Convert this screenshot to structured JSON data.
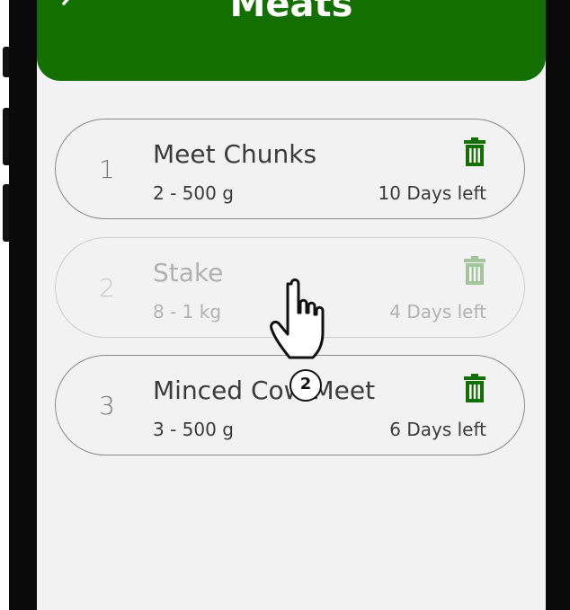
{
  "header": {
    "title": "Meats",
    "back_icon": "chevron-left-icon"
  },
  "items": [
    {
      "index": "1",
      "name": "Meet Chunks",
      "quantity": "2 - 500 g",
      "days_left": "10 Days left"
    },
    {
      "index": "2",
      "name": "Stake",
      "quantity": "8 - 1 kg",
      "days_left": "4 Days left"
    },
    {
      "index": "3",
      "name": "Minced Cow Meet",
      "quantity": "3 - 500 g",
      "days_left": "6 Days left"
    }
  ],
  "overlay": {
    "step_number": "2",
    "pointer_icon": "hand-pointer-icon"
  },
  "colors": {
    "header": "#137000",
    "trash": "#137000",
    "background": "#f2f2f2"
  }
}
